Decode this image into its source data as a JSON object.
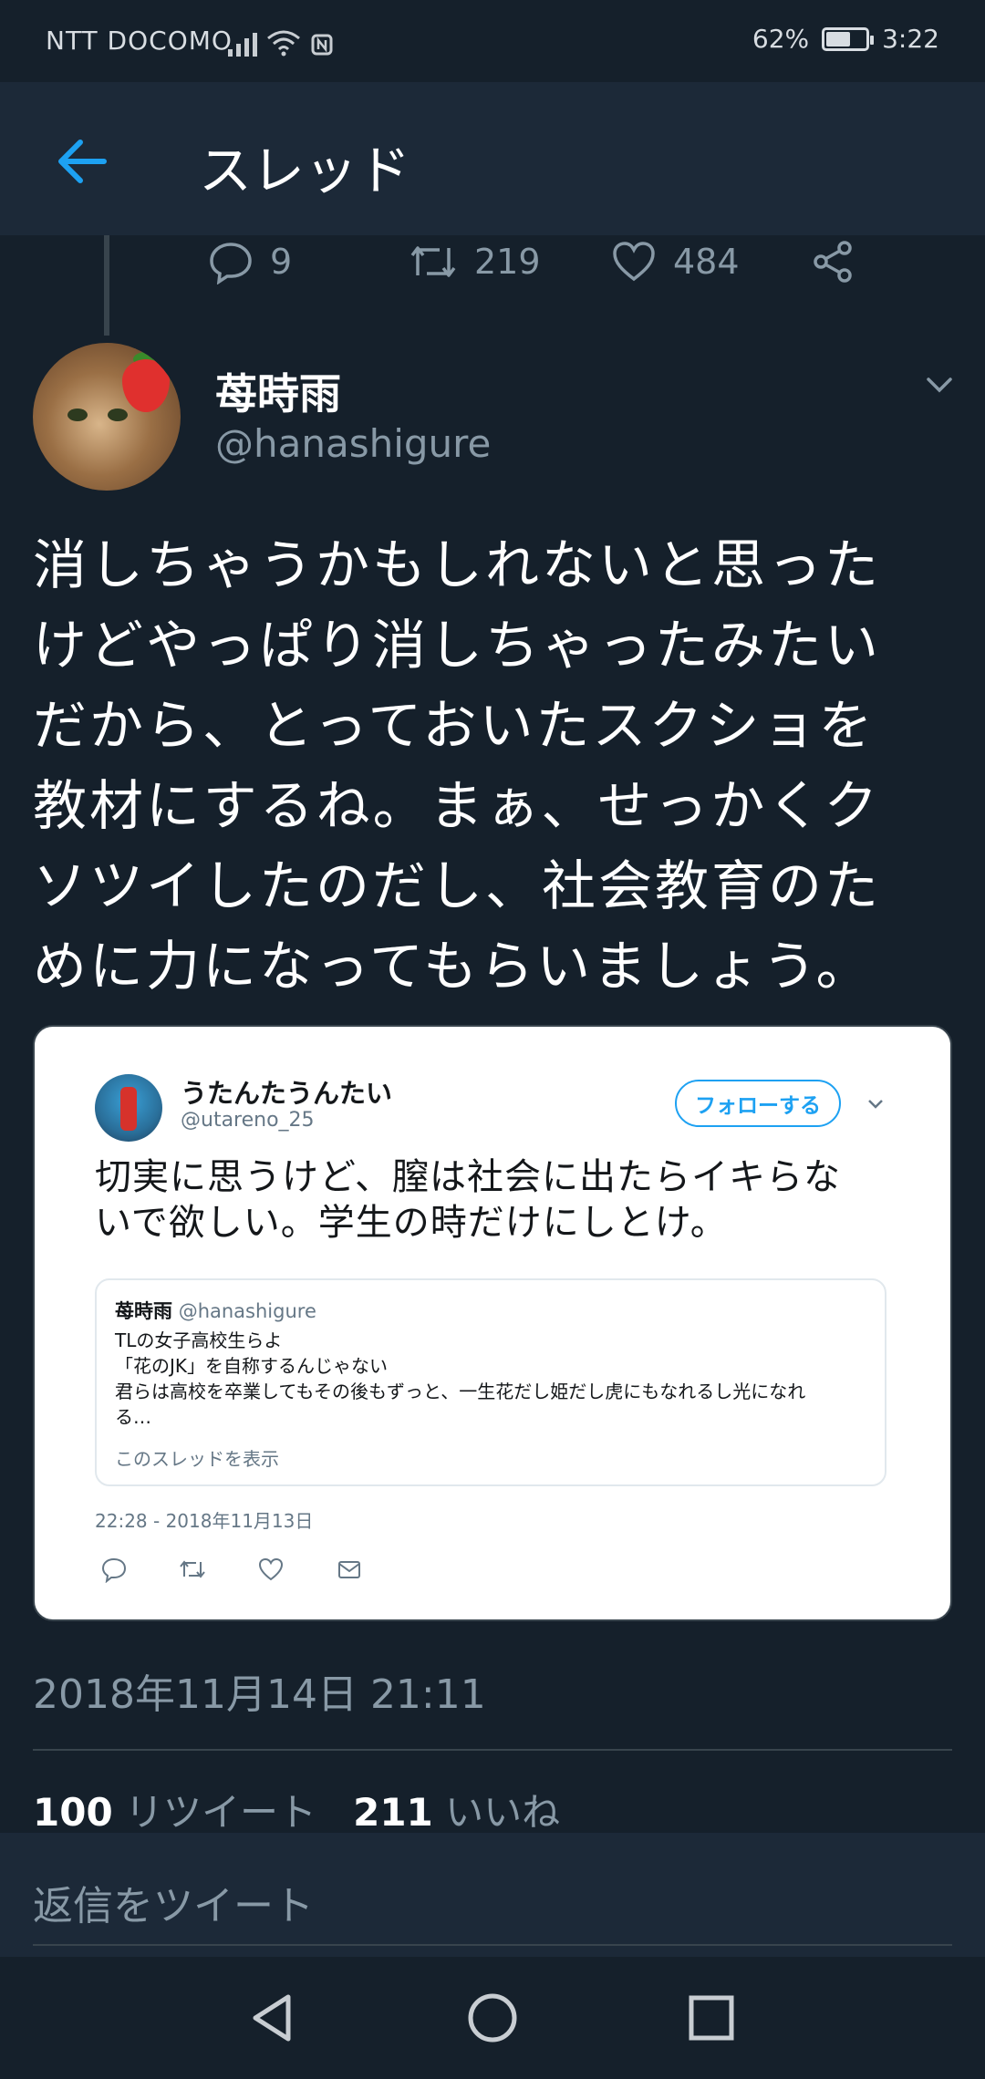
{
  "status_bar": {
    "carrier": "NTT DOCOMO",
    "battery": "62%",
    "battery_level": 0.62,
    "time": "3:22"
  },
  "header": {
    "title": "スレッド",
    "back_icon": "arrow-left-icon"
  },
  "prev_tweet_actions": {
    "replies": "9",
    "retweets": "219",
    "likes": "484"
  },
  "tweet": {
    "name": "苺時雨",
    "handle": "@hanashigure",
    "text_lines": [
      "消しちゃうかもしれないと思った",
      "けどやっぱり消しちゃったみたい",
      "だから、とっておいたスクショを",
      "教材にするね。まぁ、せっかくク",
      "ソツイしたのだし、社会教育のた",
      "めに力になってもらいましょう。"
    ],
    "timestamp": "2018年11月14日 21:11",
    "retweet_count": "100",
    "retweet_label": "リツイート",
    "like_count": "211",
    "like_label": "いいね"
  },
  "embedded_screenshot": {
    "name": "うたんたうんたい",
    "handle": "@utareno_25",
    "follow_label": "フォローする",
    "text_lines": [
      "切実に思うけど、膣は社会に出たらイキらな",
      "いで欲しい。学生の時だけにしとけ。"
    ],
    "quote": {
      "name": "苺時雨",
      "handle": "@hanashigure",
      "lines": [
        "TLの女子高校生らよ",
        "「花のJK」を自称するんじゃない",
        "君らは高校を卒業してもその後もずっと、一生花だし姫だし虎にもなれるし光になれ",
        "る…"
      ],
      "show_thread": "このスレッドを表示"
    },
    "time": "22:28 - 2018年11月13日"
  },
  "reply": {
    "placeholder": "返信をツイート"
  },
  "colors": {
    "background": "#15202b",
    "header": "#1c2938",
    "accent": "#1da1f2",
    "muted": "#8899a6"
  }
}
